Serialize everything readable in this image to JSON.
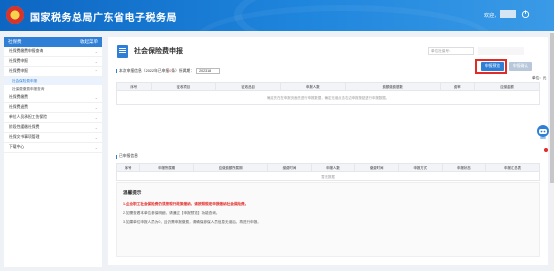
{
  "header": {
    "site_title": "国家税务总局广东省电子税务局",
    "welcome": "欢迎，"
  },
  "sidebar": {
    "title": "社保费",
    "collapse_label": "收起菜单",
    "items": [
      {
        "label": "社保费缴费申报查询",
        "prefix": ""
      },
      {
        "label": "社保费申报",
        "prefix": ""
      },
      {
        "label": "社保费申报",
        "prefix": ""
      },
      {
        "label": "社保费缴费",
        "prefix": ""
      },
      {
        "label": "社保费退费",
        "prefix": ""
      },
      {
        "label": "单位人员承担工伤保险",
        "prefix": ""
      },
      {
        "label": "阶段性缓缴社保费",
        "prefix": ""
      },
      {
        "label": "社保文书事项管理",
        "prefix": ""
      },
      {
        "label": "下载中心",
        "prefix": ""
      }
    ],
    "sub_items": [
      {
        "label": "社会保险费申报"
      },
      {
        "label": "社保费缴费申报查询"
      }
    ]
  },
  "main": {
    "page_title": "社会保险费申报",
    "tax_code_label": "单位社保号：",
    "declare_button": "申报预览",
    "second_button": "申报确认",
    "section1": {
      "title_pre": "本次申报信息（2022年已申报",
      "count": "0",
      "title_mid": "条）所属期：",
      "period": "202318"
    },
    "unit_label": "单位：元",
    "table1": {
      "headers": [
        "序号",
        "征收项目",
        "征收品目",
        "申报人数",
        "费额缴费基数",
        "费率",
        "应缴金额"
      ],
      "empty_text": "确定先在在申报页面先进行申报数据，确定无误点击右边申报按钮进行申报数据。"
    },
    "section2": {
      "title": "已申报信息"
    },
    "table2": {
      "headers": [
        "序号",
        "申报所属期",
        "应缴费额所属期",
        "缴费时间",
        "申报人数",
        "缴费时间",
        "申报方式",
        "申报状态",
        "申报汇总表"
      ],
      "empty_text": "暂无数据"
    },
    "tips": {
      "title": "温馨提示",
      "lines": [
        "1.企业职工社会保险费仍须按现行政策缴纳，请按照规定申报缴纳社会保险费。",
        "2.如需查看本单位参保明细，请通过【申报预览】功能查询。",
        "3.如果单位申报人员为0，且仍需申报缴费，请确保参保人员信息无误后，再进行申报。"
      ]
    }
  },
  "colors": {
    "brand_blue": "#2f7fd6",
    "highlight_red": "#e02b27"
  }
}
